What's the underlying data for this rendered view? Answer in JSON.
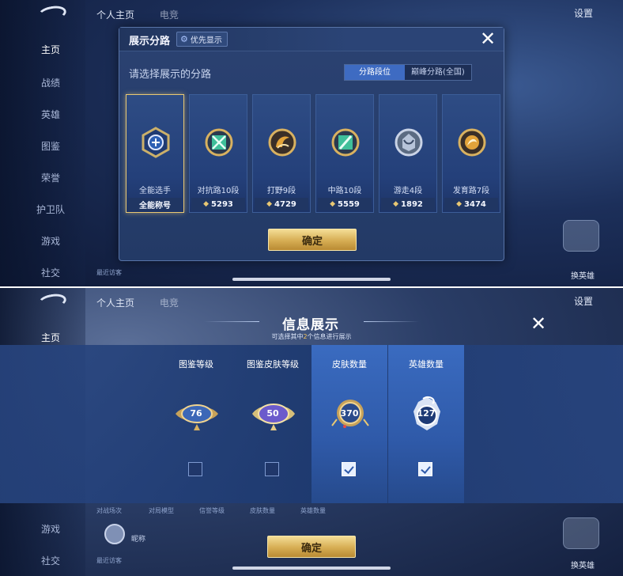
{
  "background": {
    "tabs": [
      "个人主页",
      "电竞"
    ],
    "settings_label": "设置",
    "sidebar": [
      {
        "label": "主页",
        "active": true
      },
      {
        "label": "战绩",
        "active": false
      },
      {
        "label": "英雄",
        "active": false
      },
      {
        "label": "图鉴",
        "active": false
      },
      {
        "label": "荣誉",
        "active": false
      },
      {
        "label": "护卫队",
        "active": false
      },
      {
        "label": "游戏",
        "active": false
      },
      {
        "label": "社交",
        "active": false
      }
    ],
    "visitor_label": "最近访客",
    "right_button_label": "换英雄"
  },
  "route_panel": {
    "title": "展示分路",
    "priority_button": "优先显示",
    "subtitle": "请选择展示的分路",
    "segments": [
      {
        "label": "分路段位",
        "active": true
      },
      {
        "label": "巅峰分路(全国)",
        "active": false
      }
    ],
    "cards": [
      {
        "role": "全能选手",
        "value": "全能称号",
        "selected": true,
        "icon": "all-round-emblem-icon",
        "color": "#cbb06a"
      },
      {
        "role": "对抗路10段",
        "value": "5293",
        "selected": false,
        "icon": "clash-lane-emblem-icon",
        "color": "#3fbf9a"
      },
      {
        "role": "打野9段",
        "value": "4729",
        "selected": false,
        "icon": "jungle-emblem-icon",
        "color": "#d9a03c"
      },
      {
        "role": "中路10段",
        "value": "5559",
        "selected": false,
        "icon": "mid-lane-emblem-icon",
        "color": "#3fbf9a"
      },
      {
        "role": "游走4段",
        "value": "1892",
        "selected": false,
        "icon": "roam-emblem-icon",
        "color": "#b7c4d9"
      },
      {
        "role": "发育路7段",
        "value": "3474",
        "selected": false,
        "icon": "farm-lane-emblem-icon",
        "color": "#d9a03c"
      }
    ],
    "confirm": "确定"
  },
  "info_panel": {
    "title": "信息展示",
    "subtitle_pre": "可选择其中",
    "subtitle_num": "2",
    "subtitle_post": "个信息进行展示",
    "columns": [
      {
        "label": "图鉴等级",
        "value": "76",
        "checked": false,
        "icon": "codex-level-badge-icon"
      },
      {
        "label": "图鉴皮肤等级",
        "value": "50",
        "checked": false,
        "icon": "skin-level-badge-icon"
      },
      {
        "label": "皮肤数量",
        "value": "370",
        "checked": true,
        "icon": "skin-count-badge-icon"
      },
      {
        "label": "英雄数量",
        "value": "127",
        "checked": true,
        "icon": "hero-count-badge-icon"
      }
    ],
    "lower_row": [
      "对战场次",
      "对局模型",
      "信誉等级",
      "皮肤数量",
      "英雄数量"
    ],
    "confirm": "确定",
    "nickname": "昵称"
  }
}
